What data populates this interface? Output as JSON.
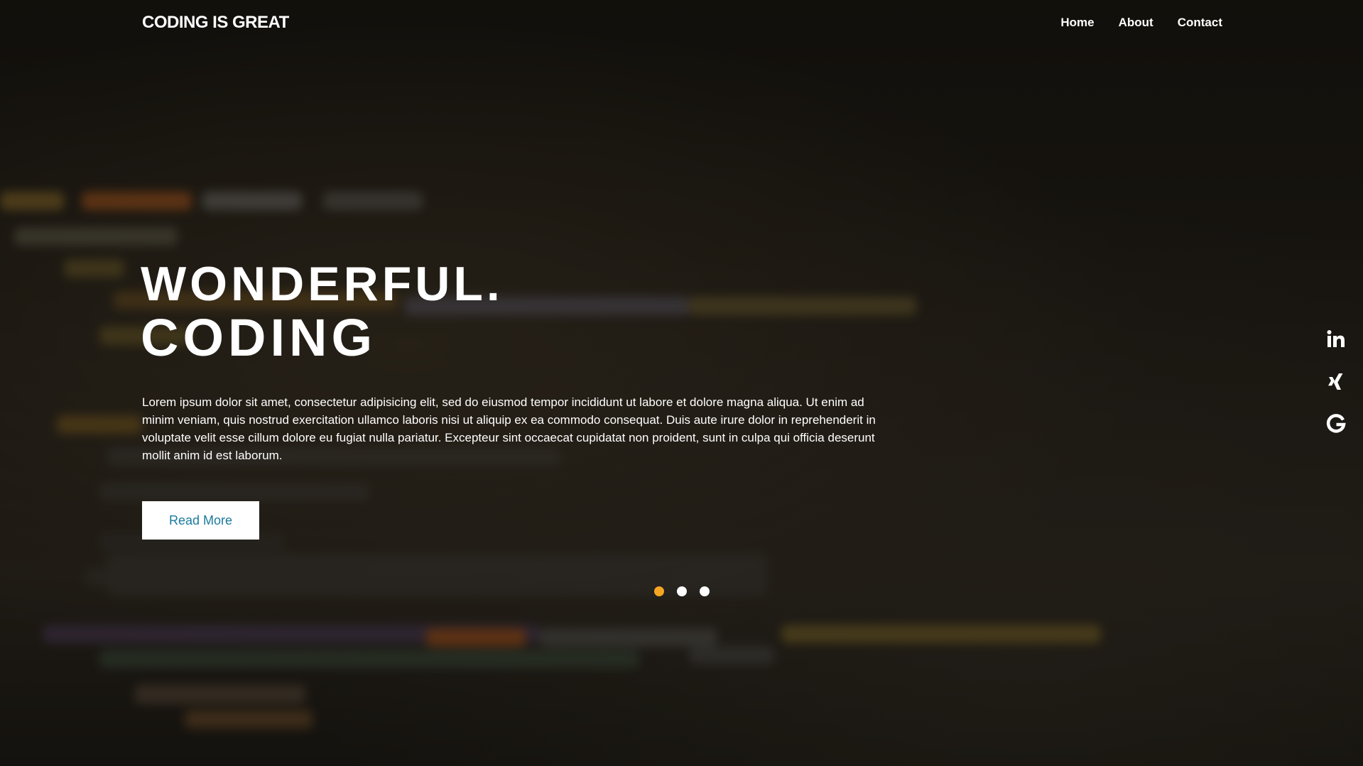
{
  "header": {
    "brand": "CODING IS GREAT",
    "nav": [
      {
        "label": "Home"
      },
      {
        "label": "About"
      },
      {
        "label": "Contact"
      }
    ]
  },
  "hero": {
    "title_line1": "WONDERFUL.",
    "title_line2": "CODING",
    "body": "Lorem ipsum dolor sit amet, consectetur adipisicing elit, sed do eiusmod tempor incididunt ut labore et dolore magna aliqua. Ut enim ad minim veniam, quis nostrud exercitation ullamco laboris nisi ut aliquip ex ea commodo consequat. Duis aute irure dolor in reprehenderit in voluptate velit esse cillum dolore eu fugiat nulla pariatur. Excepteur sint occaecat cupidatat non proident, sunt in culpa qui officia deserunt mollit anim id est laborum.",
    "cta_label": "Read More"
  },
  "slider": {
    "slide_count": 3,
    "active_index": 0
  },
  "social": [
    {
      "icon": "linkedin-icon"
    },
    {
      "icon": "xing-icon"
    },
    {
      "icon": "google-icon"
    }
  ],
  "colors": {
    "accent": "#f5a623",
    "cta_text": "#1b7a9e",
    "text": "#ffffff"
  }
}
